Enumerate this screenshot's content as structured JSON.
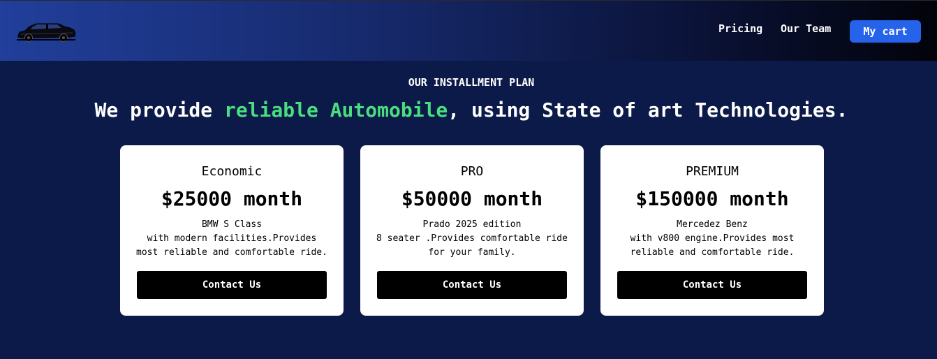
{
  "nav": {
    "logo_icon": "vintage-car-icon",
    "links": [
      "Pricing",
      "Our Team"
    ],
    "cart_label": "My cart"
  },
  "hero": {
    "eyebrow": "OUR INSTALLMENT PLAN",
    "headline_before": "We provide ",
    "headline_highlight": "reliable Automobile",
    "headline_after": ", using State of art Technologies."
  },
  "plans": [
    {
      "name": "Economic",
      "price": "$25000 month",
      "desc_lines": [
        "BMW S Class",
        "with modern facilities.Provides",
        "most reliable and comfortable ride."
      ],
      "button": "Contact Us"
    },
    {
      "name": "PRO",
      "price": "$50000 month",
      "desc_lines": [
        "Prado 2025 edition",
        "8 seater .Provides comfortable ride",
        "for your family."
      ],
      "button": "Contact Us"
    },
    {
      "name": "PREMIUM",
      "price": "$150000 month",
      "desc_lines": [
        "Mercedez Benz",
        "with v800 engine.Provides most",
        "reliable and comfortable ride."
      ],
      "button": "Contact Us"
    }
  ],
  "colors": {
    "page_bg": "#0b1a48",
    "accent_green": "#4ade80",
    "cart_blue": "#2563eb"
  }
}
